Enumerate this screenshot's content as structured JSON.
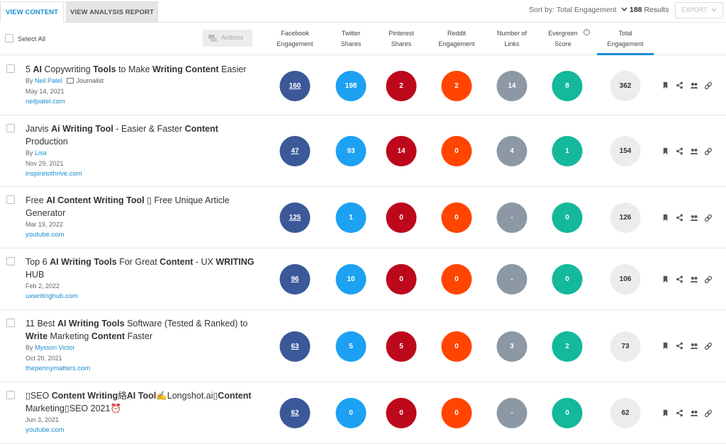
{
  "tabs": {
    "view_content": "VIEW CONTENT",
    "view_analysis": "VIEW ANALYSIS REPORT"
  },
  "toolbar": {
    "sort_label": "Sort by: Total Engagement",
    "results_count": "188",
    "results_label": "Results",
    "export_label": "EXPORT"
  },
  "header": {
    "select_all": "Select All",
    "actions": "Actions",
    "columns": [
      {
        "line1": "Facebook",
        "line2": "Engagement"
      },
      {
        "line1": "Twitter",
        "line2": "Shares"
      },
      {
        "line1": "Pinterest",
        "line2": "Shares"
      },
      {
        "line1": "Reddit",
        "line2": "Engagement"
      },
      {
        "line1": "Number of",
        "line2": "Links"
      },
      {
        "line1": "Evergreen",
        "line2": "Score"
      },
      {
        "line1": "Total",
        "line2": "Engagement"
      }
    ]
  },
  "colors": {
    "accent": "#1a8ccf",
    "facebook": "#3b5998",
    "twitter": "#1da1f2",
    "pinterest": "#bd081c",
    "reddit": "#ff4500",
    "links": "#8c98a4",
    "evergreen": "#14b89a",
    "total": "#ececec"
  },
  "rows": [
    {
      "title_html": "5 <b>AI</b> Copywriting <b>Tools</b> to Make <b>Writing Content</b> Easier",
      "by": "By",
      "author": "Neil Patel",
      "journalist": "Journalist",
      "date": "May 14, 2021",
      "domain": "neilpatel.com",
      "fb": "160",
      "tw": "198",
      "pin": "2",
      "rd": "2",
      "links": "14",
      "ev": "8",
      "total": "362"
    },
    {
      "title_html": "Jarvis <b>Ai Writing Tool</b> - Easier &amp; Faster <b>Content</b> Production",
      "by": "By",
      "author": "Lisa",
      "journalist": "",
      "date": "Nov 29, 2021",
      "domain": "inspiretothrive.com",
      "fb": "47",
      "tw": "93",
      "pin": "14",
      "rd": "0",
      "links": "4",
      "ev": "1",
      "total": "154"
    },
    {
      "title_html": "Free <b>AI Content Writing Tool</b> &#x25AF; Free Unique Article Generator",
      "by": "",
      "author": "",
      "journalist": "",
      "date": "Mar 19, 2022",
      "domain": "youtube.com",
      "fb": "125",
      "tw": "1",
      "pin": "0",
      "rd": "0",
      "links": "-",
      "ev": "0",
      "total": "126"
    },
    {
      "title_html": "Top 6 <b>AI Writing Tools</b> For Great <b>Content</b> - UX <b>WRITING</b> HUB",
      "by": "",
      "author": "",
      "journalist": "",
      "date": "Feb 2, 2022",
      "domain": "uxwritinghub.com",
      "fb": "96",
      "tw": "10",
      "pin": "0",
      "rd": "0",
      "links": "-",
      "ev": "0",
      "total": "106"
    },
    {
      "title_html": "11 Best <b>AI Writing Tools</b> Software (Tested &amp; Ranked) to <b>Write</b> Marketing <b>Content</b> Faster",
      "by": "By",
      "author": "Mysson Victor",
      "journalist": "",
      "date": "Oct 20, 2021",
      "domain": "thepennymatters.com",
      "fb": "63",
      "tw": "5",
      "pin": "5",
      "rd": "0",
      "links": "3",
      "ev": "2",
      "total": "73"
    },
    {
      "title_html": "&#x25AF;SEO <b>Content Writing</b>&#x7D61;<b>AI Tool</b>&#x270D;Longshot.ai&#x25AF;<b>Content</b> Marketing&#x25AF;SEO 2021&#x23F0;",
      "by": "",
      "author": "",
      "journalist": "",
      "date": "Jun 3, 2021",
      "domain": "youtube.com",
      "fb": "62",
      "tw": "0",
      "pin": "0",
      "rd": "0",
      "links": "-",
      "ev": "0",
      "total": "62"
    }
  ],
  "row_icons": [
    "bookmark-icon",
    "share-icon",
    "users-icon",
    "link-icon"
  ]
}
